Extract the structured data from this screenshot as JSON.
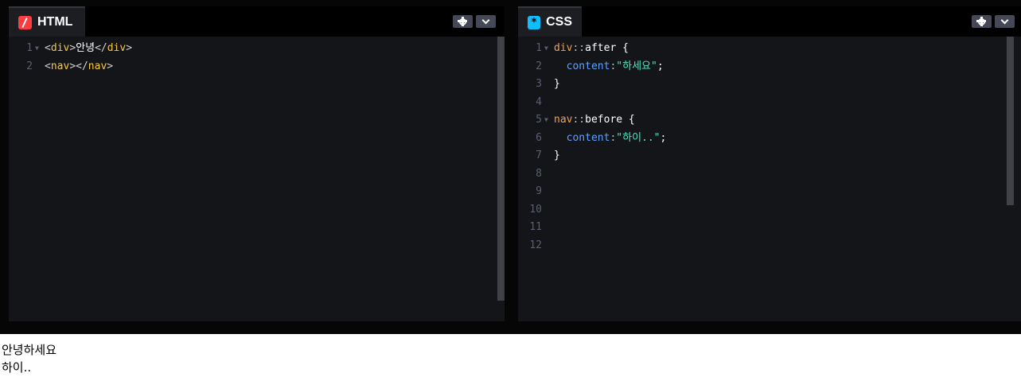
{
  "html_pane": {
    "tab_label": "HTML",
    "icon": "html-logo-icon",
    "lines": [
      {
        "num": "1",
        "tokens": [
          [
            "<",
            "bracket"
          ],
          [
            "div",
            "tag"
          ],
          [
            ">",
            "bracket"
          ],
          [
            "안녕",
            "text"
          ],
          [
            "</",
            "bracket"
          ],
          [
            "div",
            "tag"
          ],
          [
            ">",
            "bracket"
          ]
        ]
      },
      {
        "num": "2",
        "tokens": [
          [
            "<",
            "bracket"
          ],
          [
            "nav",
            "tag"
          ],
          [
            "></",
            "bracket"
          ],
          [
            "nav",
            "tag"
          ],
          [
            ">",
            "bracket"
          ]
        ]
      }
    ]
  },
  "css_pane": {
    "tab_label": "CSS",
    "icon": "css-logo-icon",
    "lines": [
      {
        "num": "1",
        "tokens": [
          [
            "div",
            "sel"
          ],
          [
            "::",
            "punc"
          ],
          [
            "after",
            "brace"
          ],
          [
            " {",
            "brace"
          ]
        ]
      },
      {
        "num": "2",
        "tokens": [
          [
            "  ",
            "text"
          ],
          [
            "content",
            "prop"
          ],
          [
            ":",
            "punc"
          ],
          [
            "\"하세요\"",
            "str"
          ],
          [
            ";",
            "brace"
          ]
        ]
      },
      {
        "num": "3",
        "tokens": [
          [
            "}",
            "brace"
          ]
        ]
      },
      {
        "num": "4",
        "tokens": []
      },
      {
        "num": "5",
        "tokens": [
          [
            "nav",
            "sel"
          ],
          [
            "::",
            "punc"
          ],
          [
            "before",
            "brace"
          ],
          [
            " {",
            "brace"
          ]
        ]
      },
      {
        "num": "6",
        "tokens": [
          [
            "  ",
            "text"
          ],
          [
            "content",
            "prop"
          ],
          [
            ":",
            "punc"
          ],
          [
            "\"하이..\"",
            "str"
          ],
          [
            ";",
            "brace"
          ]
        ]
      },
      {
        "num": "7",
        "tokens": [
          [
            "}",
            "brace"
          ]
        ]
      },
      {
        "num": "8",
        "tokens": []
      },
      {
        "num": "9",
        "tokens": []
      },
      {
        "num": "10",
        "tokens": []
      },
      {
        "num": "11",
        "tokens": []
      },
      {
        "num": "12",
        "tokens": []
      }
    ]
  },
  "result": {
    "line1": "안녕하세요",
    "line2": "하이.."
  },
  "colors": {
    "html_accent": "#ff3c41",
    "css_accent": "#0ebeff",
    "tag": "#f5c745",
    "selector": "#f5a04c",
    "property": "#5fa0ff",
    "string": "#50e3c2"
  }
}
